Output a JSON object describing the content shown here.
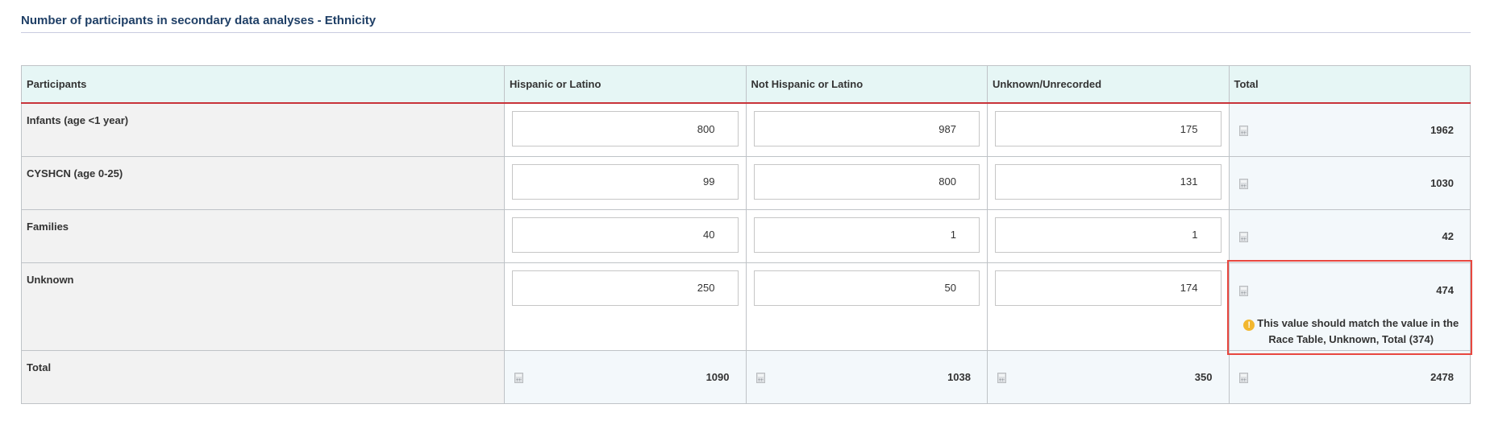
{
  "section": {
    "title": "Number of participants in secondary data analyses - Ethnicity"
  },
  "table": {
    "headers": [
      "Participants",
      "Hispanic or Latino",
      "Not Hispanic or Latino",
      "Unknown/Unrecorded",
      "Total"
    ],
    "rows": [
      {
        "label": "Infants (age <1 year)",
        "values": [
          "800",
          "987",
          "175"
        ],
        "total": "1962"
      },
      {
        "label": "CYSHCN (age 0-25)",
        "values": [
          "99",
          "800",
          "131"
        ],
        "total": "1030"
      },
      {
        "label": "Families",
        "values": [
          "40",
          "1",
          "1"
        ],
        "total": "42"
      },
      {
        "label": "Unknown",
        "values": [
          "250",
          "50",
          "174"
        ],
        "total": "474",
        "warning": "This value should match the value in the Race Table, Unknown, Total (374)"
      }
    ],
    "total_row": {
      "label": "Total",
      "values": [
        "1090",
        "1038",
        "350"
      ],
      "total": "2478"
    }
  },
  "icons": {
    "calculator": "calculator-icon",
    "warning": "exclamation-circle-icon"
  },
  "colors": {
    "title": "#1f3f66",
    "header_bg": "#e6f6f5",
    "header_underline": "#c8333a",
    "warning_icon": "#f2b72f",
    "highlight_box": "#e8473f"
  }
}
